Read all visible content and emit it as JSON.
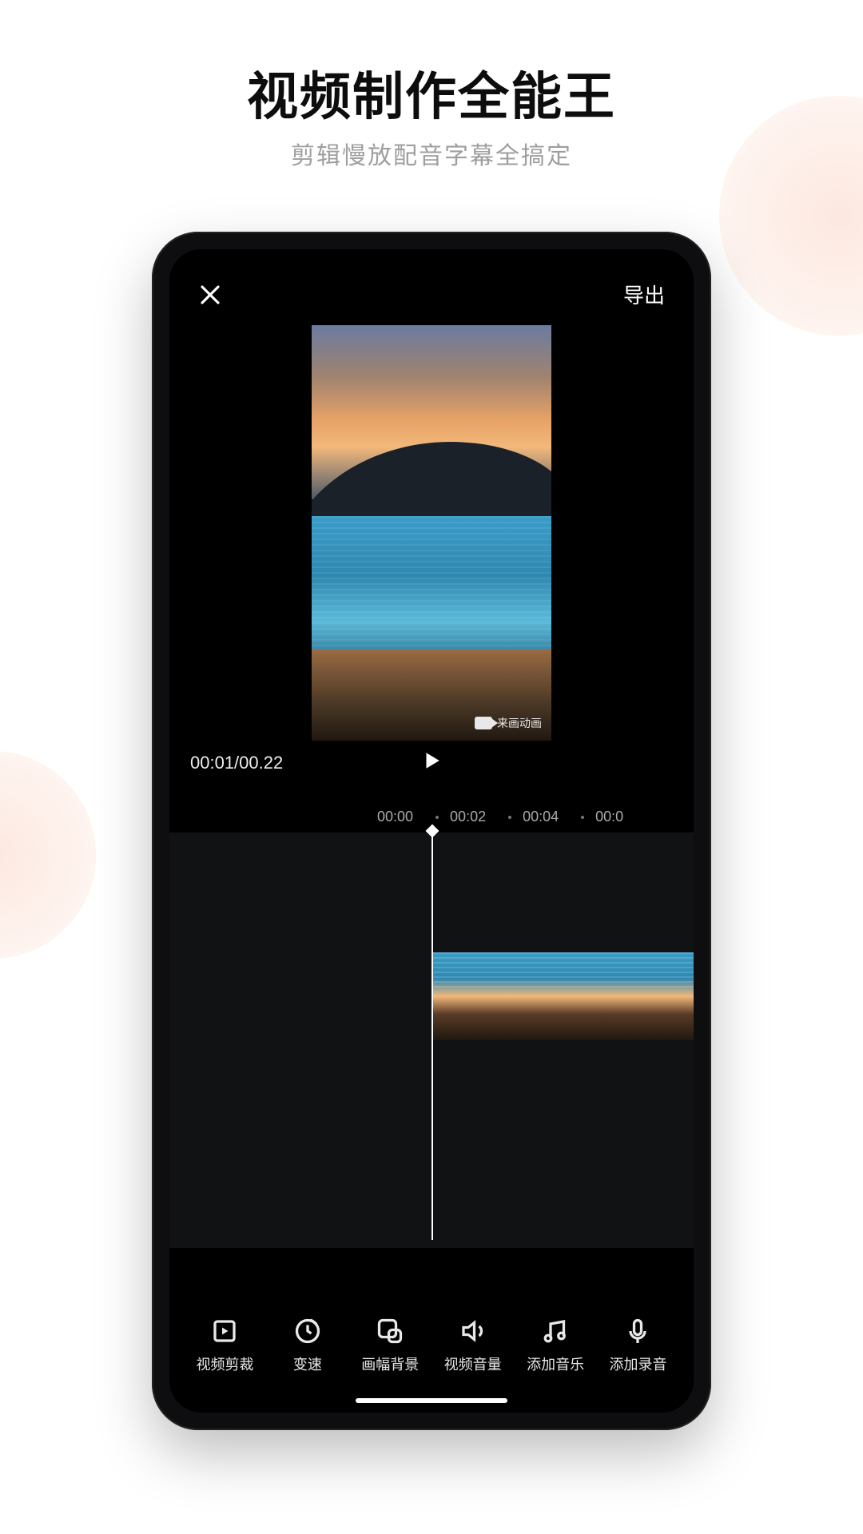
{
  "hero": {
    "title": "视频制作全能王",
    "subtitle": "剪辑慢放配音字幕全搞定"
  },
  "topBar": {
    "export_label": "导出"
  },
  "watermark": {
    "text": "来画动画"
  },
  "playbar": {
    "time": "00:01/00.22"
  },
  "ruler": {
    "marks": [
      "00:00",
      "00:02",
      "00:04",
      "00:0"
    ]
  },
  "toolbar": {
    "items": [
      {
        "label": "视频剪裁"
      },
      {
        "label": "变速"
      },
      {
        "label": "画幅背景"
      },
      {
        "label": "视频音量"
      },
      {
        "label": "添加音乐"
      },
      {
        "label": "添加录音"
      }
    ]
  }
}
